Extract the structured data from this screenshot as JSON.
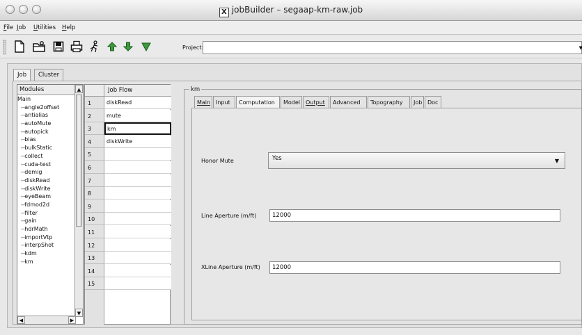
{
  "window": {
    "title": "jobBuilder – segaap-km-raw.job"
  },
  "menu": [
    "File",
    "Job",
    "Utilities",
    "Help"
  ],
  "toolbar": {
    "icons": [
      "new-file-icon",
      "open-folder-icon",
      "save-icon",
      "print-icon",
      "run-job-icon",
      "move-up-icon",
      "move-down-icon",
      "filter-icon"
    ],
    "project_label": "Project:",
    "project_value": ""
  },
  "tabs": {
    "job": "Job",
    "cluster": "Cluster"
  },
  "modules": {
    "header": "Modules",
    "root": "Main",
    "items": [
      "angle2offset",
      "antialias",
      "autoMute",
      "autopick",
      "bias",
      "bulkStatic",
      "collect",
      "cuda-test",
      "demig",
      "diskRead",
      "diskWrite",
      "eyeBeam",
      "fdmod2d",
      "filter",
      "gain",
      "hdrMath",
      "importVtp",
      "interpShot",
      "kdm",
      "km"
    ]
  },
  "job_flow": {
    "header": "Job Flow",
    "rows": [
      {
        "num": "1",
        "value": "diskRead"
      },
      {
        "num": "2",
        "value": "mute"
      },
      {
        "num": "3",
        "value": "km"
      },
      {
        "num": "4",
        "value": "diskWrite"
      },
      {
        "num": "5",
        "value": ""
      },
      {
        "num": "6",
        "value": ""
      },
      {
        "num": "7",
        "value": ""
      },
      {
        "num": "8",
        "value": ""
      },
      {
        "num": "9",
        "value": ""
      },
      {
        "num": "10",
        "value": ""
      },
      {
        "num": "11",
        "value": ""
      },
      {
        "num": "12",
        "value": ""
      },
      {
        "num": "13",
        "value": ""
      },
      {
        "num": "14",
        "value": ""
      },
      {
        "num": "15",
        "value": ""
      }
    ],
    "selected": "3"
  },
  "params_panel": {
    "title": "km",
    "tabs": [
      "Main",
      "Input",
      "Computation",
      "Model",
      "Output",
      "Advanced",
      "Topography",
      "Job",
      "Doc"
    ],
    "selected_tab": "Computation",
    "honor_mute": {
      "label": "Honor Mute",
      "value": "Yes"
    },
    "line_aperture": {
      "label": "Line Aperture (m/ft)",
      "value": "12000"
    },
    "xline_aperture": {
      "label": "XLine Aperture (m/ft)",
      "value": "12000"
    }
  }
}
